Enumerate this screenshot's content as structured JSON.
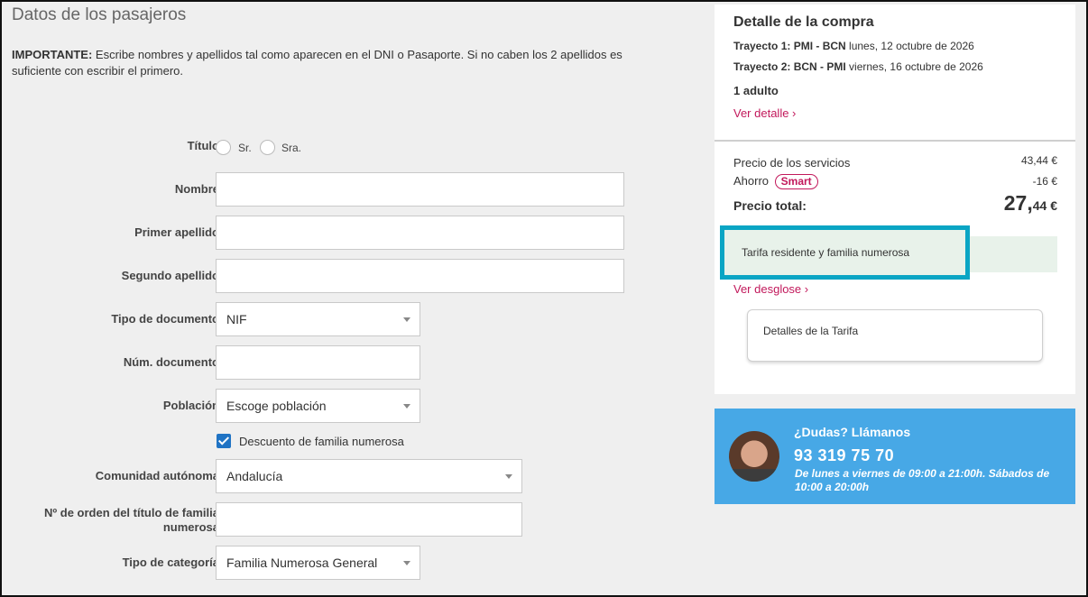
{
  "form": {
    "title": "Datos de los pasajeros",
    "important_label": "IMPORTANTE:",
    "important_text": " Escribe nombres y apellidos tal como aparecen en el DNI o Pasaporte. Si no caben los 2 apellidos es suficiente con escribir el primero.",
    "titulo_label": "Título",
    "titulo_options": [
      "Sr.",
      "Sra."
    ],
    "nombre_label": "Nombre",
    "primer_apellido_label": "Primer apellido",
    "segundo_apellido_label": "Segundo apellido",
    "tipo_documento_label": "Tipo de documento",
    "tipo_documento_value": "NIF",
    "num_documento_label": "Núm. documento",
    "poblacion_label": "Población",
    "poblacion_value": "Escoge población",
    "descuento_label": "Descuento de familia numerosa",
    "comunidad_label": "Comunidad autónoma",
    "comunidad_value": "Andalucía",
    "orden_label_1": "Nº de orden del título de familia",
    "orden_label_2": "numerosa",
    "categoria_label": "Tipo de categoría",
    "categoria_value": "Familia Numerosa General"
  },
  "purchase": {
    "title": "Detalle de la compra",
    "trip1_label": "Trayecto 1: PMI - BCN",
    "trip1_date": " lunes, 12 octubre de 2026",
    "trip2_label": "Trayecto 2: BCN - PMI",
    "trip2_date": " viernes, 16 octubre de 2026",
    "passengers": "1 adulto",
    "ver_detalle": "Ver detalle ›",
    "services_label": "Precio de los servicios",
    "services_value": "43,44 €",
    "ahorro_label": "Ahorro",
    "smart_badge": "Smart",
    "ahorro_value": "-16 €",
    "total_label": "Precio total:",
    "total_int": "27,",
    "total_dec": "44 €",
    "tarifa_text": "Tarifa residente y familia numerosa",
    "ver_desglose": "Ver desglose ›",
    "detalles_tarifa": "Detalles de la Tarifa"
  },
  "help": {
    "title": "¿Dudas? Llámanos",
    "phone": "93 319 75 70",
    "hours": "De lunes a viernes de 09:00 a 21:00h. Sábados de 10:00 a 20:00h"
  },
  "colors": {
    "accent_link": "#c2185b",
    "help_bg": "#47a8e6",
    "highlight_border": "#0aa5c4",
    "checkbox": "#1f73c4"
  }
}
